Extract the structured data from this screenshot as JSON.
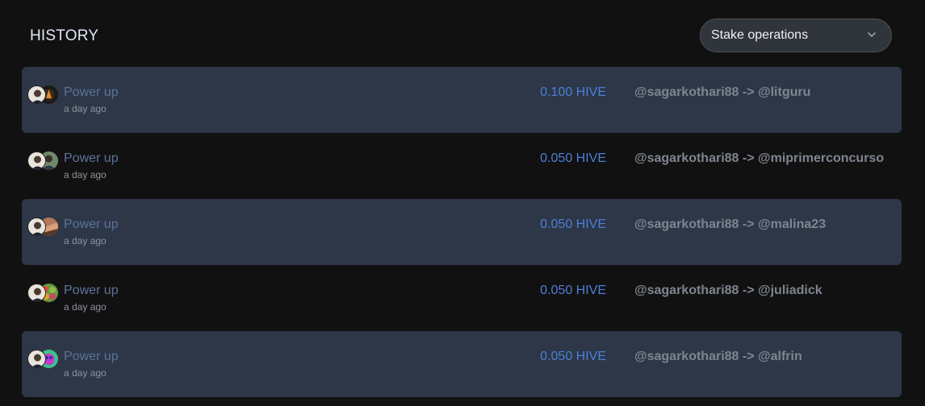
{
  "header": {
    "title": "HISTORY",
    "filter": {
      "selected": "Stake operations",
      "icon": "chevron-down-icon"
    }
  },
  "colors": {
    "background": "#121112",
    "row_highlight": "#2d3748",
    "amount": "#4c7fd6",
    "operation": "#5c7299"
  },
  "rows": [
    {
      "operation": "Power up",
      "time": "a day ago",
      "amount": "0.100 HIVE",
      "accounts": "@sagarkothari88 -> @litguru",
      "from_avatar": "avatar-sagarkothari88",
      "to_avatar": "avatar-litguru"
    },
    {
      "operation": "Power up",
      "time": "a day ago",
      "amount": "0.050 HIVE",
      "accounts": "@sagarkothari88 -> @miprimerconcurso",
      "from_avatar": "avatar-sagarkothari88",
      "to_avatar": "avatar-miprimerconcurso"
    },
    {
      "operation": "Power up",
      "time": "a day ago",
      "amount": "0.050 HIVE",
      "accounts": "@sagarkothari88 -> @malina23",
      "from_avatar": "avatar-sagarkothari88",
      "to_avatar": "avatar-malina23"
    },
    {
      "operation": "Power up",
      "time": "a day ago",
      "amount": "0.050 HIVE",
      "accounts": "@sagarkothari88 -> @juliadick",
      "from_avatar": "avatar-sagarkothari88",
      "to_avatar": "avatar-juliadick"
    },
    {
      "operation": "Power up",
      "time": "a day ago",
      "amount": "0.050 HIVE",
      "accounts": "@sagarkothari88 -> @alfrin",
      "from_avatar": "avatar-sagarkothari88",
      "to_avatar": "avatar-alfrin"
    }
  ]
}
